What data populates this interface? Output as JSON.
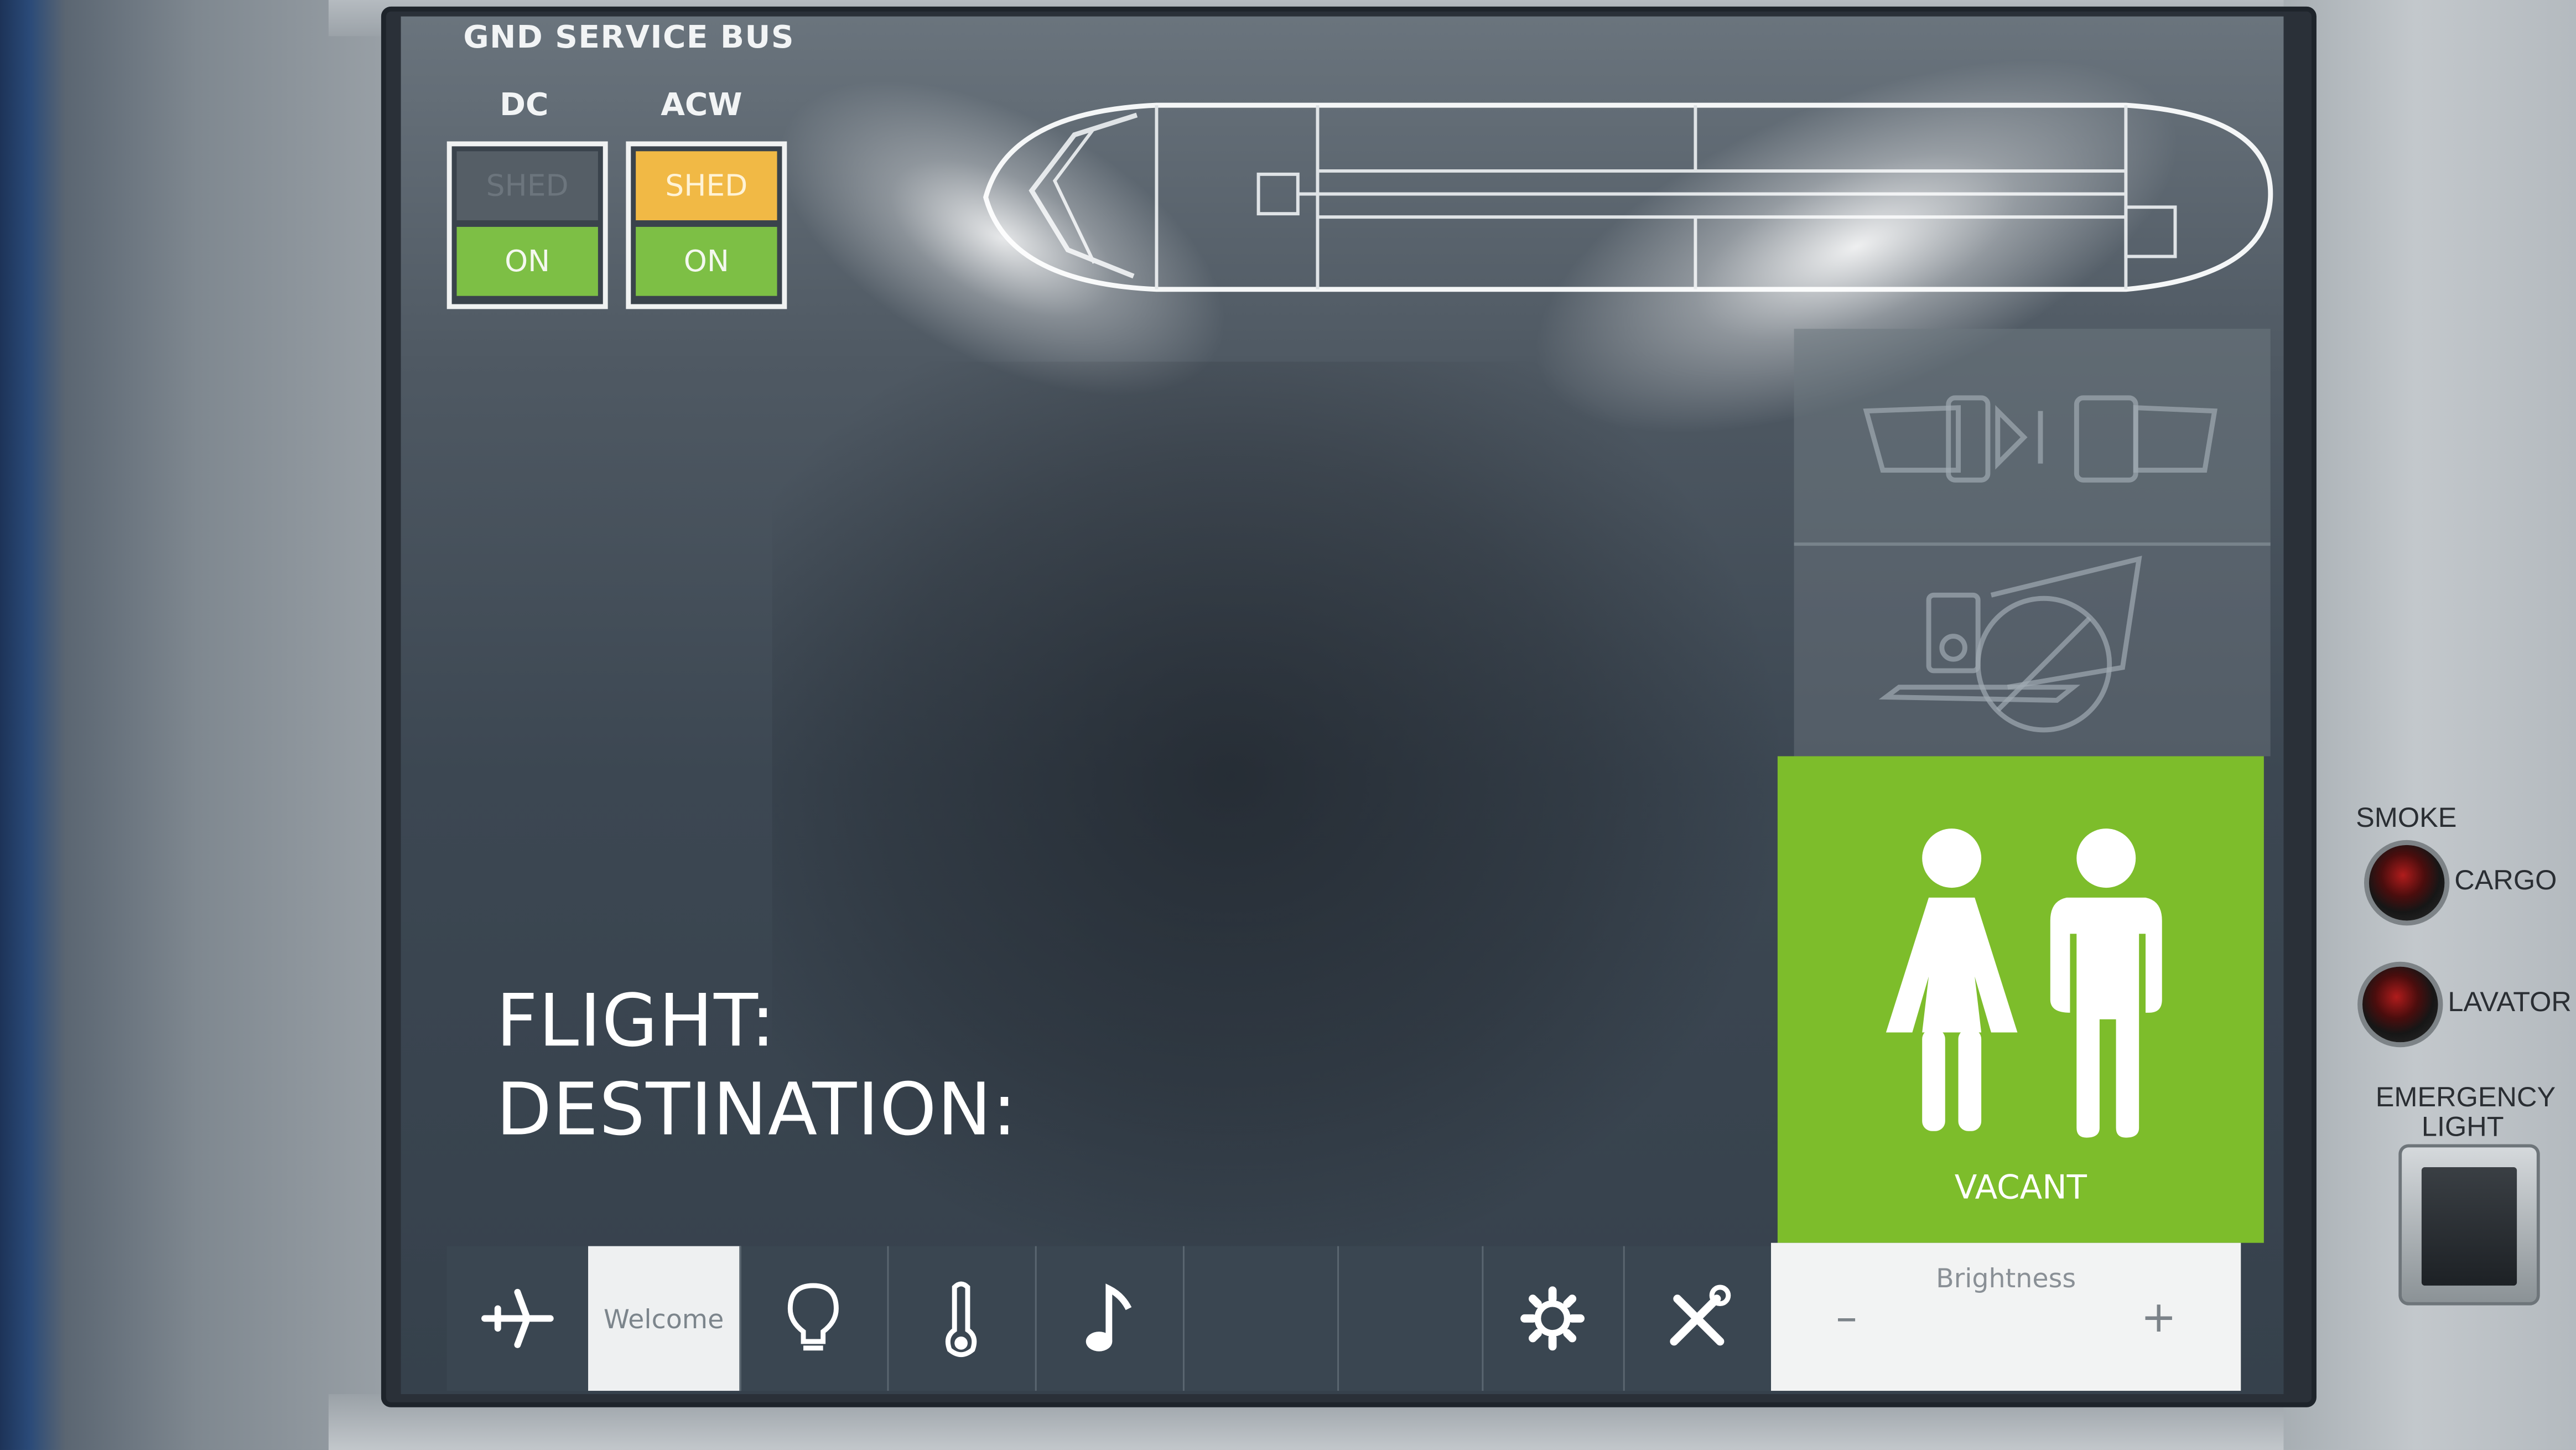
{
  "bus_panel": {
    "title": "GND SERVICE BUS",
    "dc": {
      "label": "DC",
      "shed": "SHED",
      "on": "ON",
      "shed_active": false
    },
    "acw": {
      "label": "ACW",
      "shed": "SHED",
      "on": "ON",
      "shed_active": true
    }
  },
  "info": {
    "flight_label": "FLIGHT:",
    "destination_label": "DESTINATION:"
  },
  "lavatory": {
    "status": "VACANT",
    "color": "#7dbd2b"
  },
  "toolbar": {
    "welcome_label": "Welcome",
    "brightness_label": "Brightness",
    "brightness_minus": "–",
    "brightness_plus": "+"
  },
  "physical_controls": {
    "smoke_label": "SMOKE",
    "cargo_label": "CARGO",
    "lavatory_label": "LAVATOR",
    "emergency_label": "EMERGENCY",
    "light_label": "LIGHT"
  },
  "colors": {
    "on_green": "#7dbf45",
    "shed_amber": "#f1b945",
    "screen_bg": "#3c4752"
  },
  "icons": [
    "airplane-icon",
    "bulb-icon",
    "thermometer-icon",
    "music-note-icon",
    "gear-icon",
    "tools-icon",
    "seatbelt-icon",
    "no-electronics-icon",
    "woman-icon",
    "man-icon"
  ]
}
